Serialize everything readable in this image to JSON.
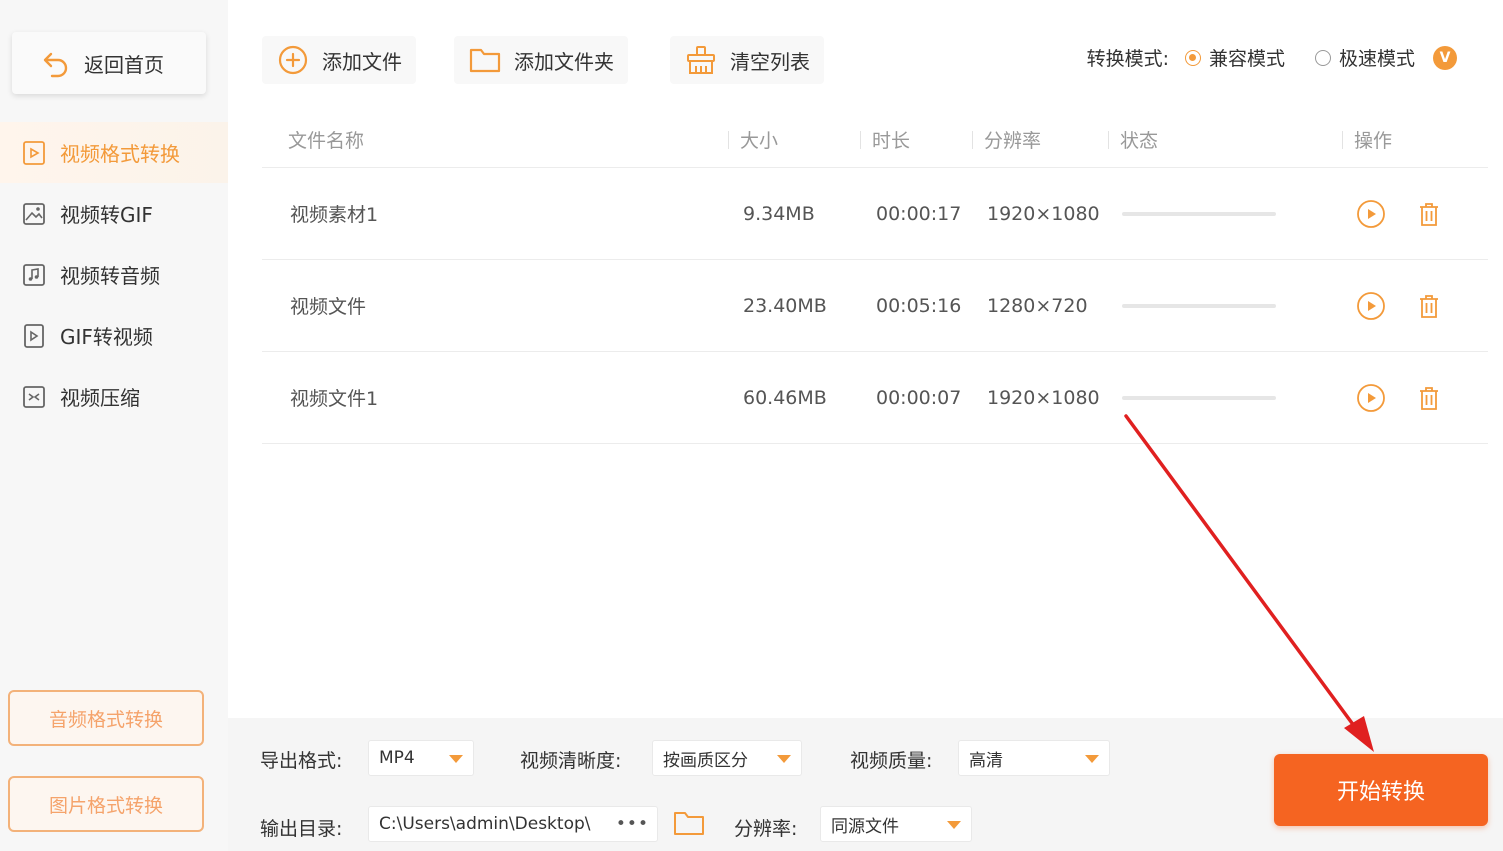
{
  "sidebar": {
    "back_label": "返回首页",
    "items": [
      {
        "label": "视频格式转换",
        "active": true
      },
      {
        "label": "视频转GIF",
        "active": false
      },
      {
        "label": "视频转音频",
        "active": false
      },
      {
        "label": "GIF转视频",
        "active": false
      },
      {
        "label": "视频压缩",
        "active": false
      }
    ],
    "audio_convert_label": "音频格式转换",
    "image_convert_label": "图片格式转换"
  },
  "toolbar": {
    "add_file_label": "添加文件",
    "add_folder_label": "添加文件夹",
    "clear_list_label": "清空列表",
    "mode_label": "转换模式:",
    "mode_compat_label": "兼容模式",
    "mode_fast_label": "极速模式",
    "vip_badge": "V"
  },
  "table": {
    "headers": {
      "name": "文件名称",
      "size": "大小",
      "duration": "时长",
      "resolution": "分辨率",
      "status": "状态",
      "action": "操作"
    },
    "rows": [
      {
        "name": "视频素材1",
        "size": "9.34MB",
        "duration": "00:00:17",
        "resolution": "1920×1080",
        "progress": 0
      },
      {
        "name": "视频文件",
        "size": "23.40MB",
        "duration": "00:05:16",
        "resolution": "1280×720",
        "progress": 0
      },
      {
        "name": "视频文件1",
        "size": "60.46MB",
        "duration": "00:00:07",
        "resolution": "1920×1080",
        "progress": 0
      }
    ]
  },
  "bottom": {
    "export_format_label": "导出格式:",
    "export_format_value": "MP4",
    "clarity_label": "视频清晰度:",
    "clarity_value": "按画质区分",
    "quality_label": "视频质量:",
    "quality_value": "高清",
    "output_dir_label": "输出目录:",
    "output_dir_value": "C:\\Users\\admin\\Desktop\\",
    "output_dir_more": "•••",
    "resolution_label": "分辨率:",
    "resolution_value": "同源文件",
    "start_label": "开始转换"
  },
  "colors": {
    "accent": "#f39a3a",
    "start_button": "#f56421",
    "annotation_arrow": "#e02020"
  }
}
